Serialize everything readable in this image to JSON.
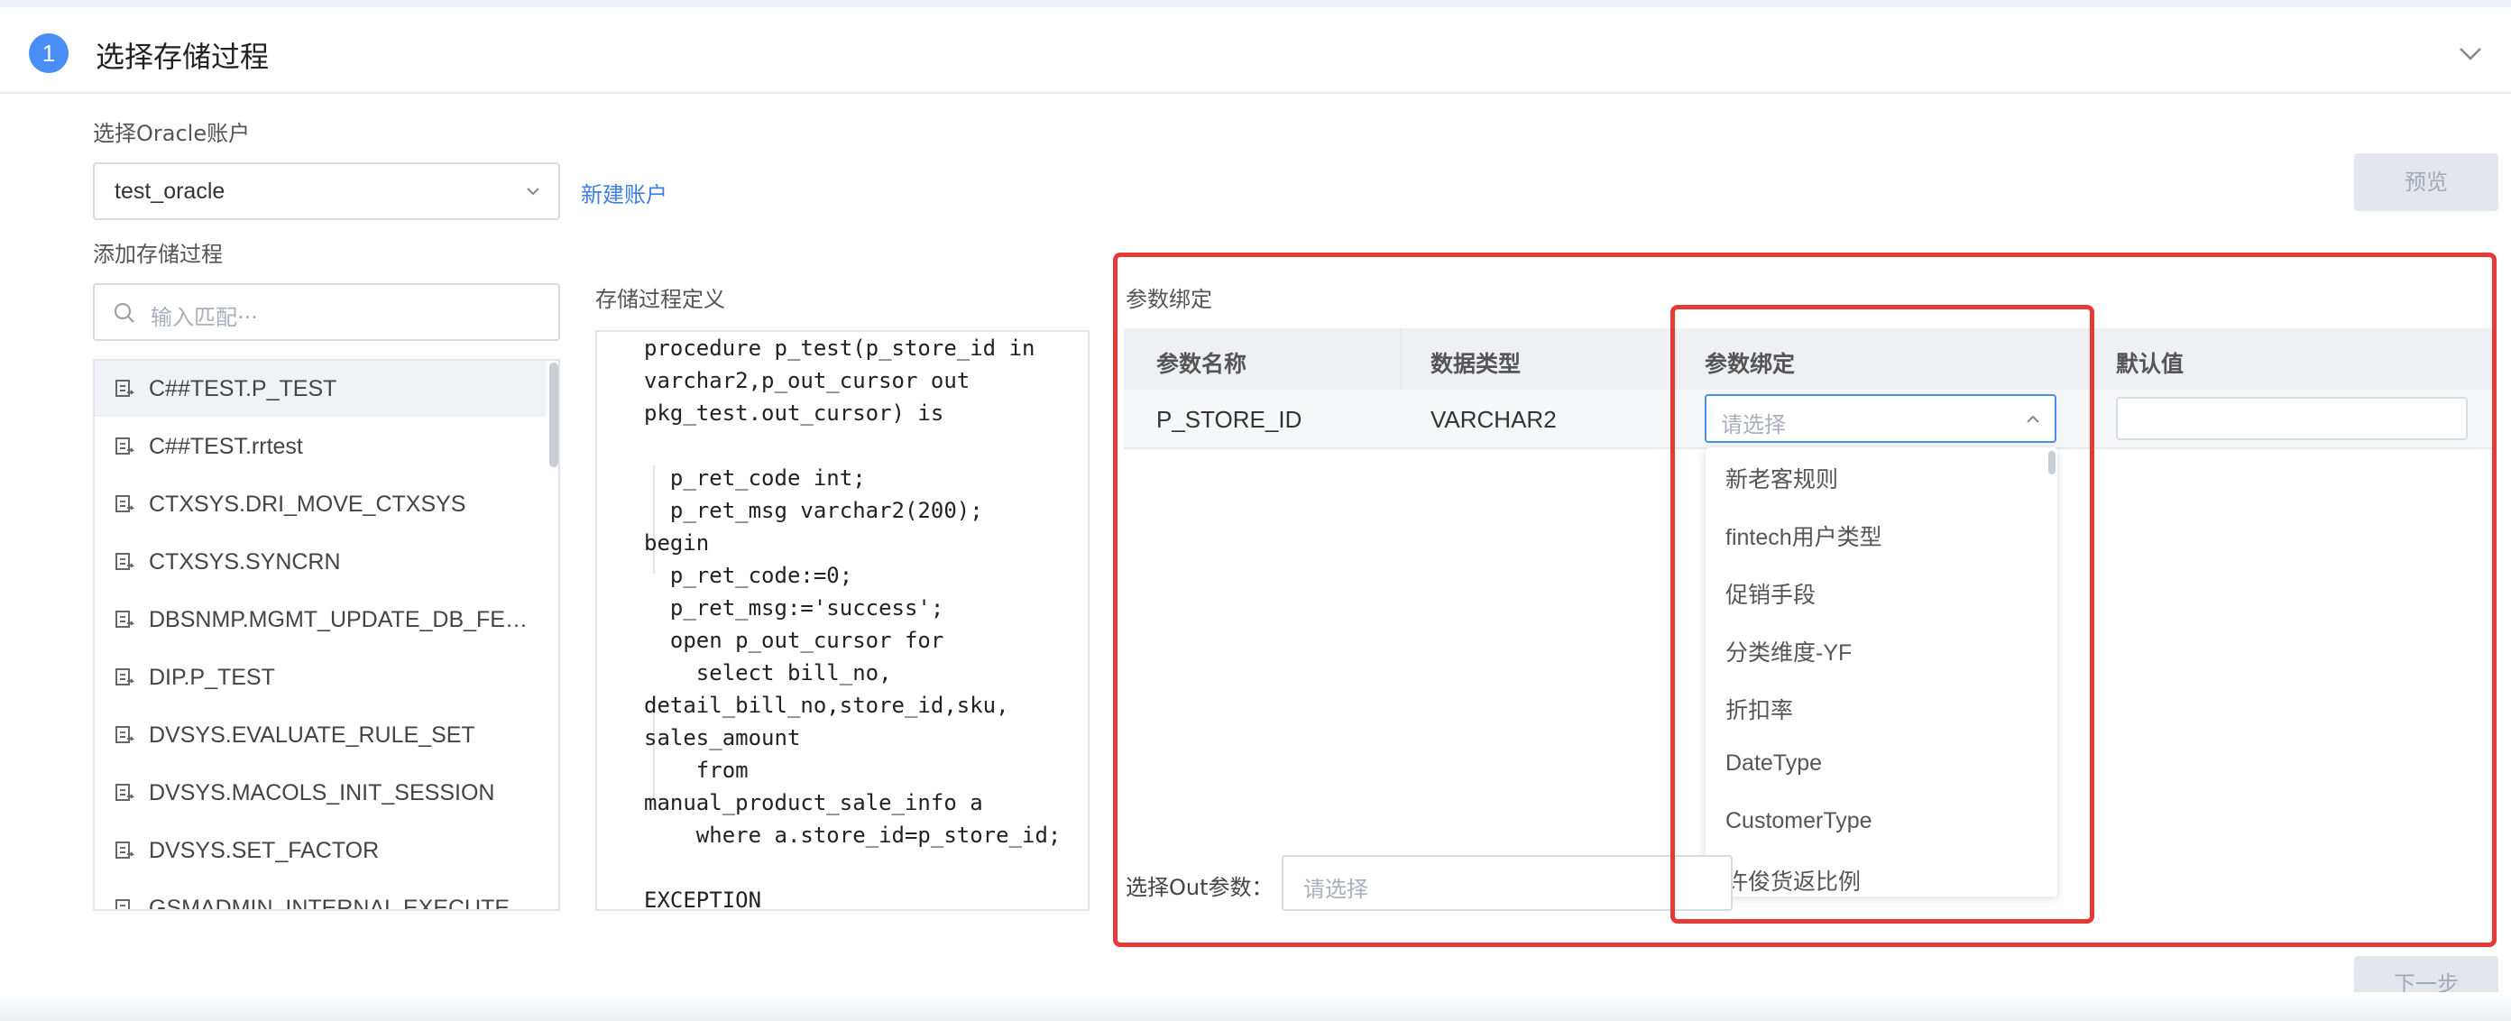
{
  "header": {
    "step_number": "1",
    "title": "选择存储过程"
  },
  "account": {
    "label": "选择Oracle账户",
    "selected": "test_oracle",
    "new_account_link": "新建账户"
  },
  "preview_button": "预览",
  "procedures": {
    "label": "添加存储过程",
    "search_placeholder": "输入匹配···",
    "items": [
      "C##TEST.P_TEST",
      "C##TEST.rrtest",
      "CTXSYS.DRI_MOVE_CTXSYS",
      "CTXSYS.SYNCRN",
      "DBSNMP.MGMT_UPDATE_DB_FEATURE_LOG",
      "DIP.P_TEST",
      "DVSYS.EVALUATE_RULE_SET",
      "DVSYS.MACOLS_INIT_SESSION",
      "DVSYS.SET_FACTOR",
      "GSMADMIN_INTERNAL.EXECUTECOMMAND"
    ]
  },
  "definition": {
    "label": "存储过程定义",
    "lines": [
      "procedure p_test(p_store_id in",
      "varchar2,p_out_cursor out",
      "pkg_test.out_cursor) is",
      "",
      "  p_ret_code int;",
      "  p_ret_msg varchar2(200);",
      "begin",
      "  p_ret_code:=0;",
      "  p_ret_msg:='success';",
      "  open p_out_cursor for",
      "    select bill_no,",
      "detail_bill_no,store_id,sku,",
      "sales_amount",
      "    from",
      "manual_product_sale_info a",
      "    where a.store_id=p_store_id;",
      "",
      "EXCEPTION"
    ]
  },
  "binding": {
    "label": "参数绑定",
    "columns": [
      "参数名称",
      "数据类型",
      "参数绑定",
      "默认值"
    ],
    "rows": [
      {
        "name": "P_STORE_ID",
        "type": "VARCHAR2",
        "bind_placeholder": "请选择",
        "default": ""
      }
    ],
    "dropdown_options": [
      "新老客规则",
      "fintech用户类型",
      "促销手段",
      "分类维度-YF",
      "折扣率",
      "DateType",
      "CustomerType",
      "许俊货返比例"
    ],
    "out_param_label": "选择Out参数：",
    "out_param_placeholder": "请选择"
  },
  "next_button": "下一步",
  "colors": {
    "accent": "#4a8ef5",
    "highlight": "#e53a35",
    "link": "#3e7fe0"
  }
}
